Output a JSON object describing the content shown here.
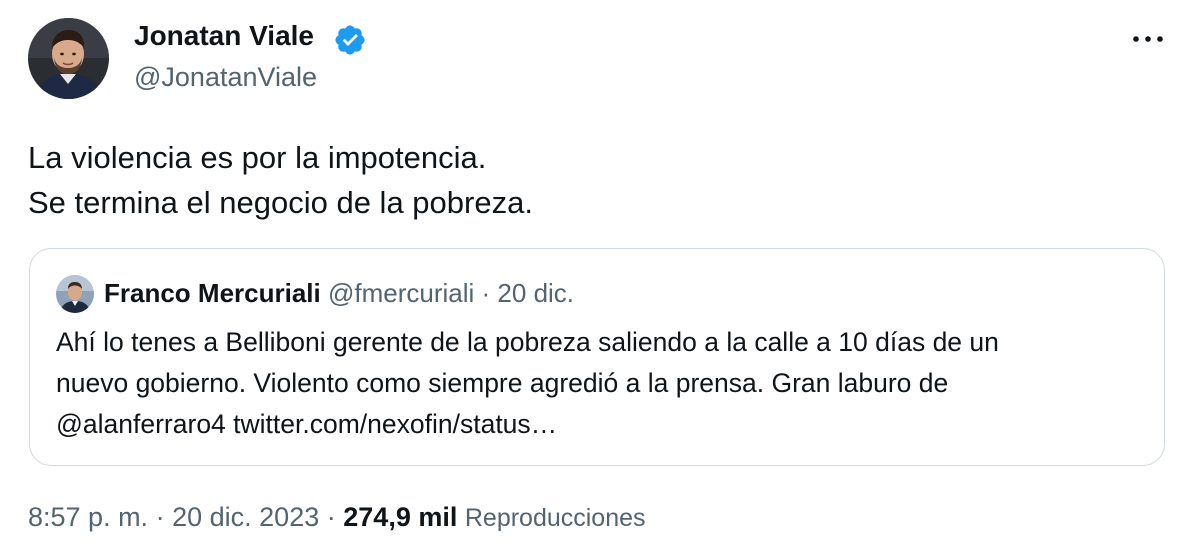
{
  "tweet": {
    "author": {
      "name": "Jonatan Viale",
      "handle": "@JonatanViale",
      "verified_icon": "verified-badge-icon",
      "verified_color": "#1d9bf0"
    },
    "more_icon": "more-options-icon",
    "text_lines": [
      "La violencia es por la impotencia.",
      "Se termina el negocio de la pobreza."
    ],
    "quote": {
      "author_name": "Franco Mercuriali",
      "author_handle": "@fmercuriali",
      "separator": "·",
      "date": "20 dic.",
      "text_lines": [
        "Ahí lo tenes a Belliboni gerente de la pobreza saliendo a la calle a 10 días de un",
        "nuevo gobierno. Violento como siempre agredió a la prensa. Gran laburo de",
        "@alanferraro4 twitter.com/nexofin/status…"
      ]
    },
    "meta": {
      "time": "8:57 p. m.",
      "separator": "·",
      "date": "20 dic. 2023",
      "separator2": "·",
      "views_count": "274,9 mil",
      "views_label": "Reproducciones"
    }
  },
  "colors": {
    "text_primary": "#0f1419",
    "text_secondary": "#536471",
    "border": "#cfd9de",
    "accent": "#1d9bf0"
  }
}
